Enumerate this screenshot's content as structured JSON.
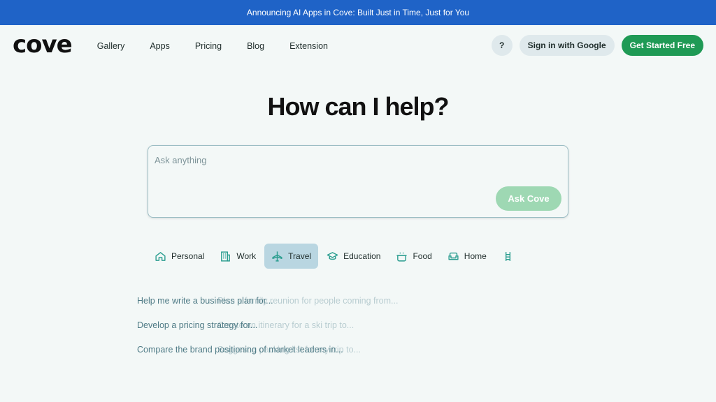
{
  "announcement": "Announcing AI Apps in Cove: Built Just in Time, Just for You",
  "brand": {
    "logo_text": "cove"
  },
  "nav": {
    "links": [
      "Gallery",
      "Apps",
      "Pricing",
      "Blog",
      "Extension"
    ],
    "help_label": "?",
    "signin_label": "Sign in with Google",
    "get_started_label": "Get Started Free"
  },
  "hero": {
    "title": "How can I help?"
  },
  "ask": {
    "placeholder": "Ask anything",
    "button_label": "Ask Cove"
  },
  "categories": {
    "items": [
      {
        "label": "Personal",
        "icon": "house-icon"
      },
      {
        "label": "Work",
        "icon": "building-icon"
      },
      {
        "label": "Travel",
        "icon": "airplane-icon",
        "active": true
      },
      {
        "label": "Education",
        "icon": "graduation-cap-icon"
      },
      {
        "label": "Food",
        "icon": "cooking-pot-icon"
      },
      {
        "label": "Home",
        "icon": "sofa-icon"
      },
      {
        "label": "",
        "icon": "ladder-icon"
      }
    ]
  },
  "suggestions": [
    {
      "text": "Help me write a business plan for...",
      "ghost": "Plan a family reunion for people coming from..."
    },
    {
      "text": "Develop a pricing strategy for...",
      "ghost": "Create an itinerary for a ski trip to..."
    },
    {
      "text": "Compare the brand positioning of market leaders in...",
      "ghost": "Suggest a packing list for my trip to..."
    }
  ],
  "colors": {
    "announcement_bg": "#1f63c7",
    "primary_green": "#1f9a55",
    "ask_button": "#9ed8b3",
    "icon_teal": "#2a9d8f",
    "active_tab": "#b9d6e1"
  }
}
